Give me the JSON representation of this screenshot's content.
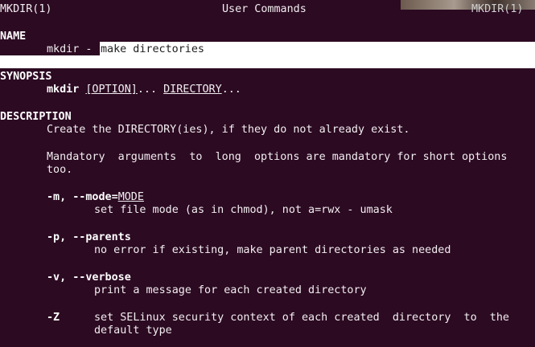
{
  "header": {
    "left": "MKDIR(1)",
    "center": "User Commands",
    "right": "MKDIR(1)"
  },
  "sections": {
    "name_heading": "NAME",
    "name_cmd": "mkdir - ",
    "name_desc": "make directories",
    "synopsis_heading": "SYNOPSIS",
    "synopsis_cmd": "mkdir",
    "synopsis_option": "[OPTION]",
    "synopsis_mid": "... ",
    "synopsis_dir": "DIRECTORY",
    "synopsis_end": "...",
    "description_heading": "DESCRIPTION",
    "desc_line1": "Create the DIRECTORY(ies), if they do not already exist.",
    "desc_line2": "Mandatory  arguments  to  long  options are mandatory for short options",
    "desc_line3": "too."
  },
  "options": [
    {
      "flag": "-m, --mode=",
      "arg": "MODE",
      "desc": "set file mode (as in chmod), not a=rwx - umask"
    },
    {
      "flag": "-p, --parents",
      "desc": "no error if existing, make parent directories as needed"
    },
    {
      "flag": "-v, --verbose",
      "desc": "print a message for each created directory"
    },
    {
      "flag": "-Z",
      "desc1": "set SELinux security context of each created  directory  to  the",
      "desc2": "default type"
    }
  ]
}
